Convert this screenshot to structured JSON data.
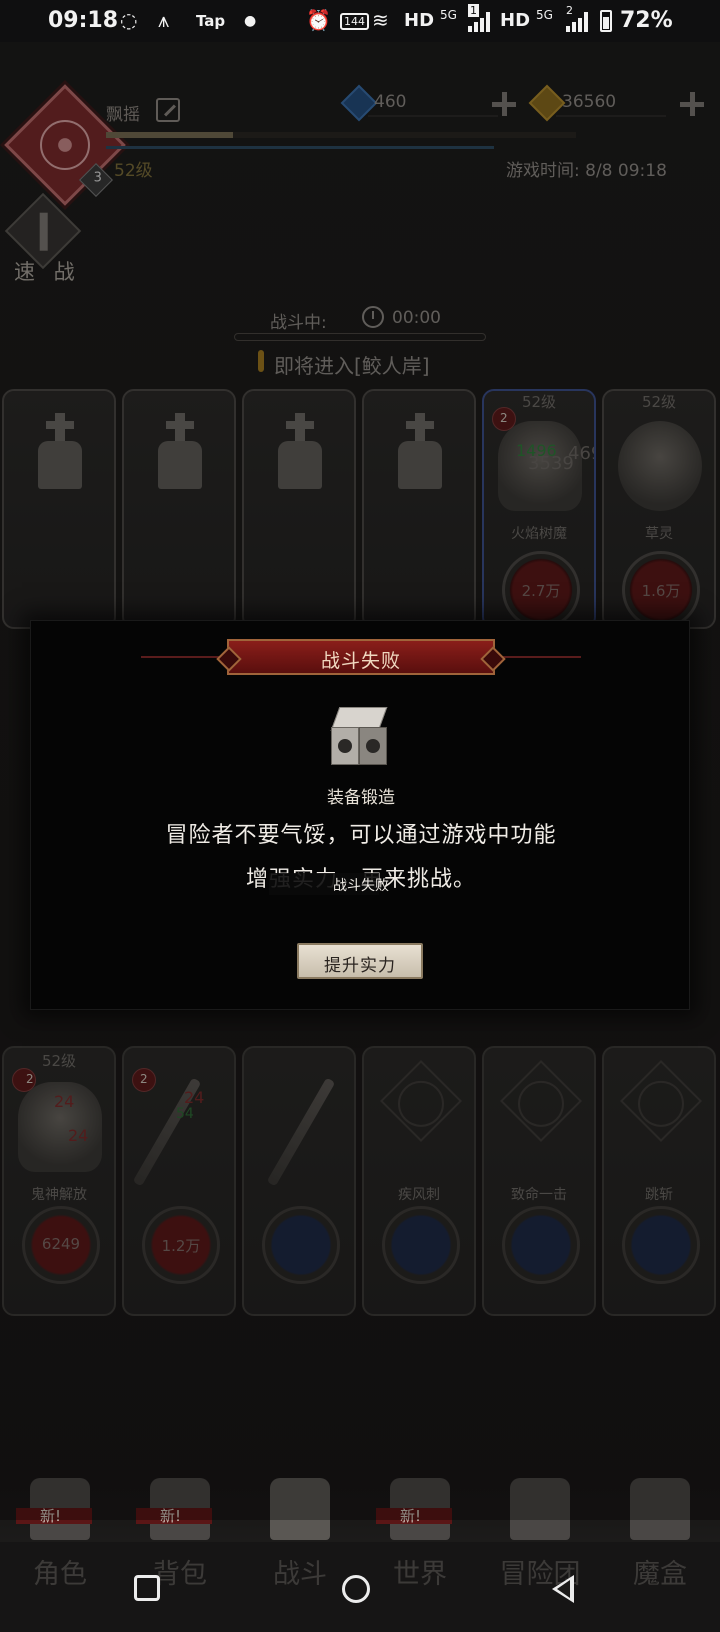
{
  "status_bar": {
    "time": "09:18",
    "tap": "Tap",
    "icon_1": "144",
    "hd1": "HD",
    "g1": "5G",
    "sim1": "1",
    "hd2": "HD",
    "g2": "5G",
    "sim2": "2",
    "battery": "72%"
  },
  "player": {
    "name": "飘摇",
    "level": "52级",
    "avatar_badge": "3",
    "exp_fraction": 0.27
  },
  "resources": {
    "gems": "460",
    "gold": "36560"
  },
  "game_time": "游戏时间: 8/8 09:18",
  "quick_battle": "速 战",
  "battle": {
    "status_label": "战斗中:",
    "timer": "00:00",
    "entering_text": "即将进入[鲛人岸]"
  },
  "enemies": {
    "card5": {
      "level": "52级",
      "name": "火焰树魔",
      "hp": "2.7万",
      "dmg_green": "1496",
      "dmg_grey": "3539",
      "dmg_grey2": "469",
      "elem_num": "2"
    },
    "card6": {
      "level": "52级",
      "name": "草灵",
      "hp": "1.6万"
    }
  },
  "skills": {
    "card1": {
      "level": "52级",
      "name": "鬼神解放",
      "value": "6249",
      "num1": "24",
      "num2": "24",
      "elem_num": "2"
    },
    "card2": {
      "value": "1.2万",
      "num1": "24",
      "num2": "54",
      "elem_num": "2"
    },
    "card4": {
      "name": "疾风刺"
    },
    "card5": {
      "name": "致命一击"
    },
    "card6": {
      "name": "跳斩"
    }
  },
  "dialog": {
    "title": "战斗失败",
    "item_label": "装备锻造",
    "message_line1": "冒险者不要气馁，可以通过游戏中功能",
    "message_line2": "增强实力，再来挑战。",
    "toast": "战斗失败",
    "button": "提升实力"
  },
  "nav": {
    "new_badge": "新!",
    "tabs": [
      "角色",
      "背包",
      "战斗",
      "世界",
      "冒险团",
      "魔盒"
    ]
  }
}
